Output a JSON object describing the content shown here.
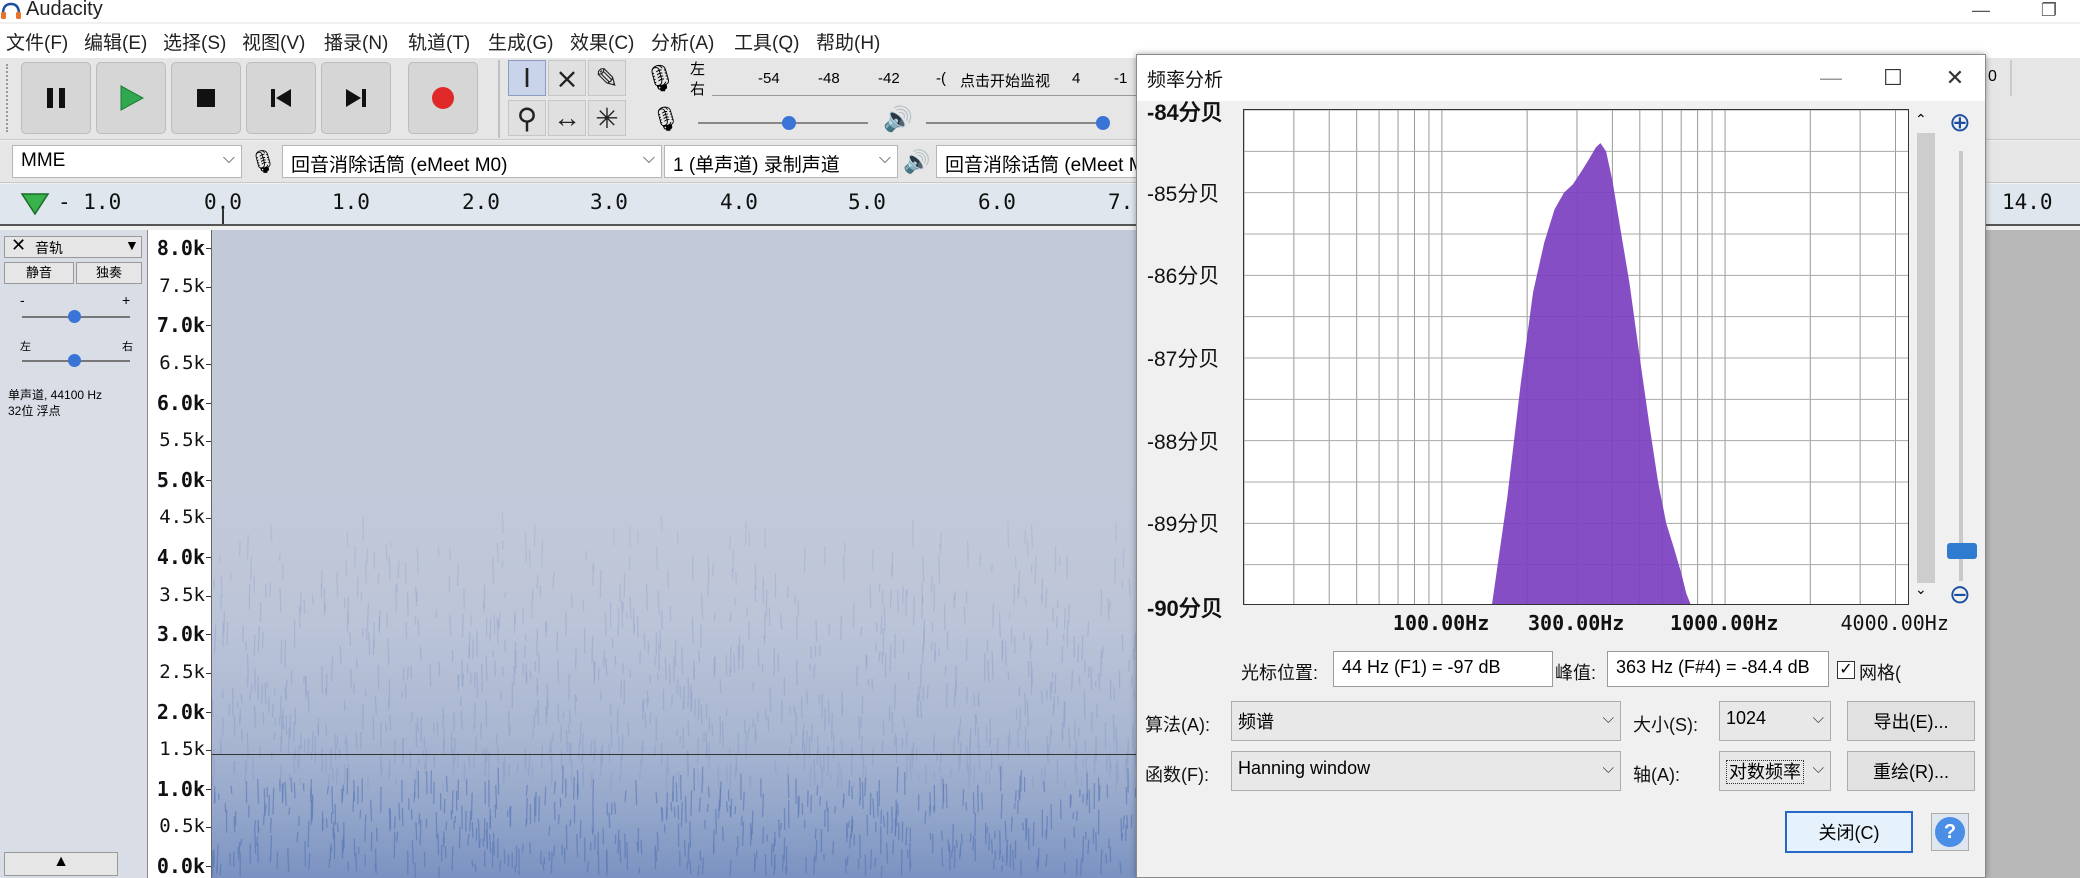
{
  "app": {
    "title": "Audacity"
  },
  "window_controls": {
    "minimize": "—",
    "restore": "❐"
  },
  "menu": [
    "文件(F)",
    "编辑(E)",
    "选择(S)",
    "视图(V)",
    "播录(N)",
    "轨道(T)",
    "生成(G)",
    "效果(C)",
    "分析(A)",
    "工具(Q)",
    "帮助(H)"
  ],
  "meter": {
    "rec_channels": [
      "左",
      "右"
    ],
    "ticks": [
      "-54",
      "-48",
      "-42",
      "-(",
      "点击开始监视",
      "4",
      "-1"
    ],
    "right_partial": "0"
  },
  "devices": {
    "host": "MME",
    "rec_device": "回音消除话筒 (eMeet M0)",
    "channels": "1 (单声道) 录制声道",
    "play_device": "回音消除话筒 (eMeet M"
  },
  "timeline": {
    "labels": [
      "- 1.0",
      "0.0",
      "1.0",
      "2.0",
      "3.0",
      "4.0",
      "5.0",
      "6.0",
      "7.",
      "14.0"
    ]
  },
  "track": {
    "name": "音轨",
    "mute": "静音",
    "solo": "独奏",
    "gain_minus": "-",
    "gain_plus": "+",
    "pan_left": "左",
    "pan_right": "右",
    "info_line1": "单声道, 44100 Hz",
    "info_line2": "32位 浮点",
    "collapse": "▲"
  },
  "vruler": {
    "labels": [
      "8.0k",
      "7.5k",
      "7.0k",
      "6.5k",
      "6.0k",
      "5.5k",
      "5.0k",
      "4.5k",
      "4.0k",
      "3.5k",
      "3.0k",
      "2.5k",
      "2.0k",
      "1.5k",
      "1.0k",
      "0.5k",
      "0.0k"
    ]
  },
  "dialog": {
    "title": "频率分析",
    "controls": {
      "minimize": "—",
      "maximize": "☐",
      "close": "✕"
    },
    "cursor_label": "光标位置:",
    "cursor_value": "44 Hz (F1) = -97 dB",
    "peak_label": "峰值:",
    "peak_value": "363 Hz (F#4) = -84.4 dB",
    "grid_label": "网格(",
    "grid_checked": true,
    "algo_label": "算法(A):",
    "algo_value": "频谱",
    "size_label": "大小(S):",
    "size_value": "1024",
    "export_button": "导出(E)...",
    "func_label": "函数(F):",
    "func_value": "Hanning window",
    "axis_label": "轴(A):",
    "axis_value": "对数频率",
    "replot_button": "重绘(R)...",
    "close_button": "关闭(C)",
    "help_button": "?"
  },
  "chart_data": {
    "type": "area",
    "title": "",
    "xlabel": "",
    "ylabel": "",
    "xscale": "log",
    "xlim": [
      20,
      4500
    ],
    "ylim": [
      -90,
      -84
    ],
    "grid": true,
    "color": "#7b3fc0",
    "yticks": [
      "-84分贝",
      "-85分贝",
      "-86分贝",
      "-87分贝",
      "-88分贝",
      "-89分贝",
      "-90分贝"
    ],
    "ytick_values": [
      -84,
      -85,
      -86,
      -87,
      -88,
      -89,
      -90
    ],
    "xticks": [
      "100.00Hz",
      "300.00Hz",
      "1000.00Hz",
      "4000.00Hz"
    ],
    "xtick_values": [
      100,
      300,
      1000,
      4000
    ],
    "series": [
      {
        "x": [
          150,
          170,
          190,
          210,
          230,
          250,
          270,
          290,
          310,
          330,
          350,
          363,
          380,
          400,
          430,
          460,
          500,
          540,
          580,
          620,
          660,
          700,
          730,
          760
        ],
        "y": [
          -90,
          -88.7,
          -87.3,
          -86.2,
          -85.6,
          -85.2,
          -85.0,
          -84.9,
          -84.75,
          -84.6,
          -84.45,
          -84.4,
          -84.5,
          -84.85,
          -85.5,
          -86.1,
          -87.0,
          -87.8,
          -88.5,
          -89.0,
          -89.3,
          -89.6,
          -89.85,
          -90
        ]
      }
    ]
  }
}
